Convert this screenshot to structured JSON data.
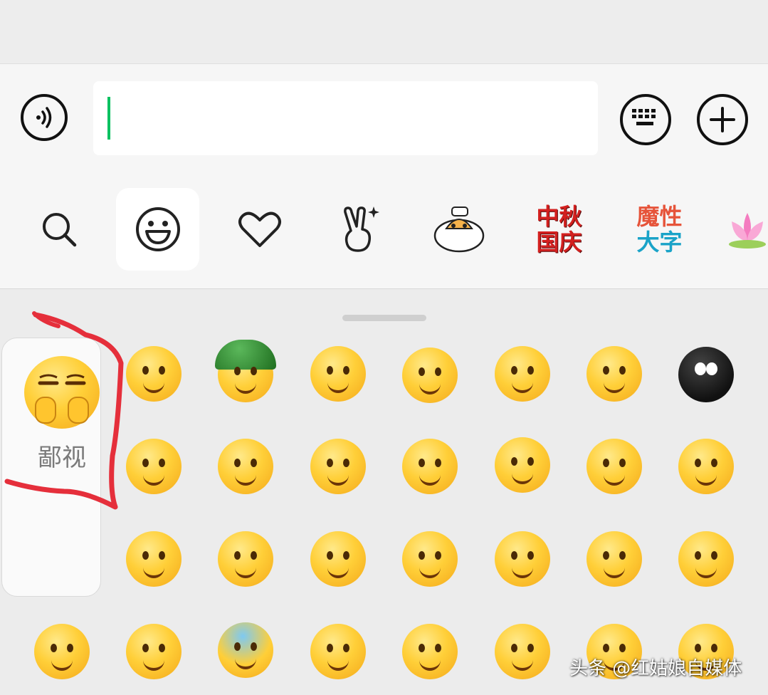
{
  "input": {
    "value": ""
  },
  "tabs": {
    "search_icon": "search-icon",
    "emoji_icon": "smiley-face-icon",
    "favorite_icon": "heart-icon",
    "sticker_icon": "peace-hand-icon",
    "mascot_icon": "tiger-bun-sticker-icon",
    "zhongqiu_text_line1": "中秋",
    "zhongqiu_text_line2": "国庆",
    "moxing_text_line1": "魔性",
    "moxing_text_line2": "大字",
    "lotus_icon": "lotus-icon"
  },
  "preview": {
    "label": "鄙视"
  },
  "watermark": {
    "text": "头条 @红姑娘自媒体"
  },
  "colors": {
    "accent_green": "#07c160",
    "annotation_red": "#e52f3b",
    "panel_bg": "#ececec"
  }
}
